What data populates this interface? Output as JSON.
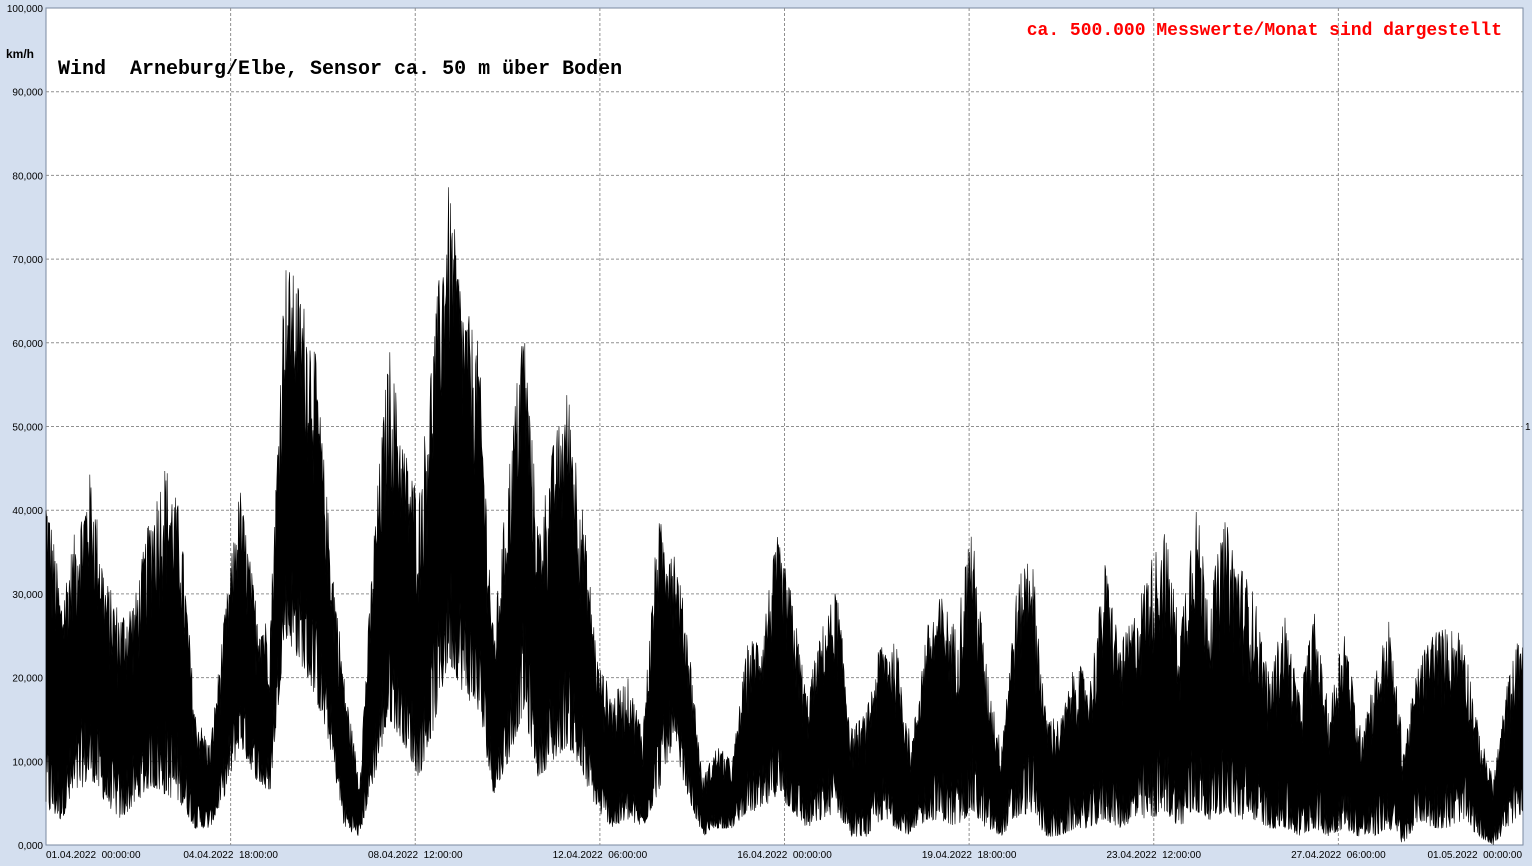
{
  "chart_data": {
    "type": "area",
    "title": "Wind  Arneburg/Elbe, Sensor ca. 50 m über Boden",
    "annotation": "ca. 500.000 Messwerte/Monat sind dargestellt",
    "annotation_color": "#ff0000",
    "series_color": "#000000",
    "ylabel": "km/h",
    "xlabel": "",
    "ylim": [
      0,
      100
    ],
    "grid": true,
    "y_ticks": [
      "0,000",
      "10,000",
      "20,000",
      "30,000",
      "40,000",
      "50,000",
      "60,000",
      "70,000",
      "80,000",
      "90,000",
      "100,000"
    ],
    "x_ticks": [
      "01.04.2022  00:00:00",
      "04.04.2022  18:00:00",
      "08.04.2022  12:00:00",
      "12.04.2022  06:00:00",
      "16.04.2022  00:00:00",
      "19.04.2022  18:00:00",
      "23.04.2022  12:00:00",
      "27.04.2022  06:00:00",
      "01.05.2022  00:00:00"
    ],
    "right_marker": "1",
    "x_range_days": [
      0,
      30
    ],
    "series": [
      {
        "values_x_days": [
          0,
          0.25,
          0.5,
          0.75,
          1,
          1.25,
          1.5,
          1.75,
          2,
          2.25,
          2.5,
          2.75,
          3,
          3.25,
          3.5,
          3.75,
          4,
          4.25,
          4.5,
          4.75,
          5,
          5.25,
          5.5,
          5.75,
          6,
          6.25,
          6.5,
          6.75,
          7,
          7.25,
          7.5,
          7.75,
          8,
          8.25,
          8.5,
          8.75,
          9,
          9.25,
          9.5,
          9.75,
          10,
          10.25,
          10.5,
          10.75,
          11,
          11.25,
          11.5,
          11.75,
          12,
          12.25,
          12.5,
          12.75,
          13,
          13.25,
          13.5,
          13.75,
          14,
          14.25,
          14.5,
          14.75,
          15,
          15.25,
          15.5,
          15.75,
          16,
          16.25,
          16.5,
          16.75,
          17,
          17.25,
          17.5,
          17.75,
          18,
          18.25,
          18.5,
          18.75,
          19,
          19.25,
          19.5,
          19.75,
          20,
          20.25,
          20.5,
          20.75,
          21,
          21.25,
          21.5,
          21.75,
          22,
          22.25,
          22.5,
          22.75,
          23,
          23.25,
          23.5,
          23.75,
          24,
          24.25,
          24.5,
          24.75,
          25,
          25.25,
          25.5,
          25.75,
          26,
          26.25,
          26.5,
          26.75,
          27,
          27.25,
          27.5,
          27.75,
          28,
          28.25,
          28.5,
          28.75,
          29,
          29.25,
          29.5,
          29.75,
          30
        ],
        "max": [
          44,
          30,
          38,
          45,
          32,
          28,
          30,
          40,
          46,
          40,
          16,
          12,
          28,
          43,
          30,
          26,
          70,
          67,
          60,
          38,
          20,
          8,
          38,
          60,
          48,
          42,
          62,
          79,
          65,
          60,
          25,
          45,
          64,
          38,
          48,
          55,
          40,
          22,
          18,
          20,
          14,
          39,
          37,
          26,
          8,
          12,
          10,
          24,
          26,
          37,
          30,
          18,
          26,
          31,
          14,
          16,
          25,
          24,
          12,
          26,
          30,
          26,
          39,
          22,
          12,
          30,
          37,
          16,
          15,
          22,
          20,
          34,
          24,
          28,
          34,
          38,
          26,
          42,
          30,
          39,
          34,
          30,
          20,
          28,
          18,
          28,
          16,
          27,
          14,
          20,
          27,
          12,
          22,
          26,
          26,
          26,
          14,
          8,
          20,
          27
        ],
        "min": [
          4,
          3,
          6,
          8,
          5,
          3,
          5,
          7,
          6,
          5,
          2,
          2,
          6,
          12,
          8,
          6,
          25,
          22,
          18,
          12,
          2,
          1,
          8,
          15,
          12,
          8,
          14,
          22,
          18,
          16,
          6,
          10,
          16,
          8,
          10,
          12,
          8,
          4,
          2,
          3,
          2,
          6,
          12,
          6,
          1,
          2,
          2,
          4,
          4,
          6,
          4,
          2,
          3,
          4,
          1,
          1,
          3,
          2,
          1,
          3,
          3,
          2,
          4,
          2,
          1,
          3,
          4,
          1,
          1,
          2,
          2,
          3,
          2,
          3,
          3,
          4,
          2,
          4,
          3,
          4,
          3,
          3,
          2,
          2,
          1,
          2,
          1,
          2,
          1,
          1,
          2,
          0,
          3,
          2,
          2,
          3,
          1,
          0,
          2,
          4
        ]
      }
    ]
  }
}
